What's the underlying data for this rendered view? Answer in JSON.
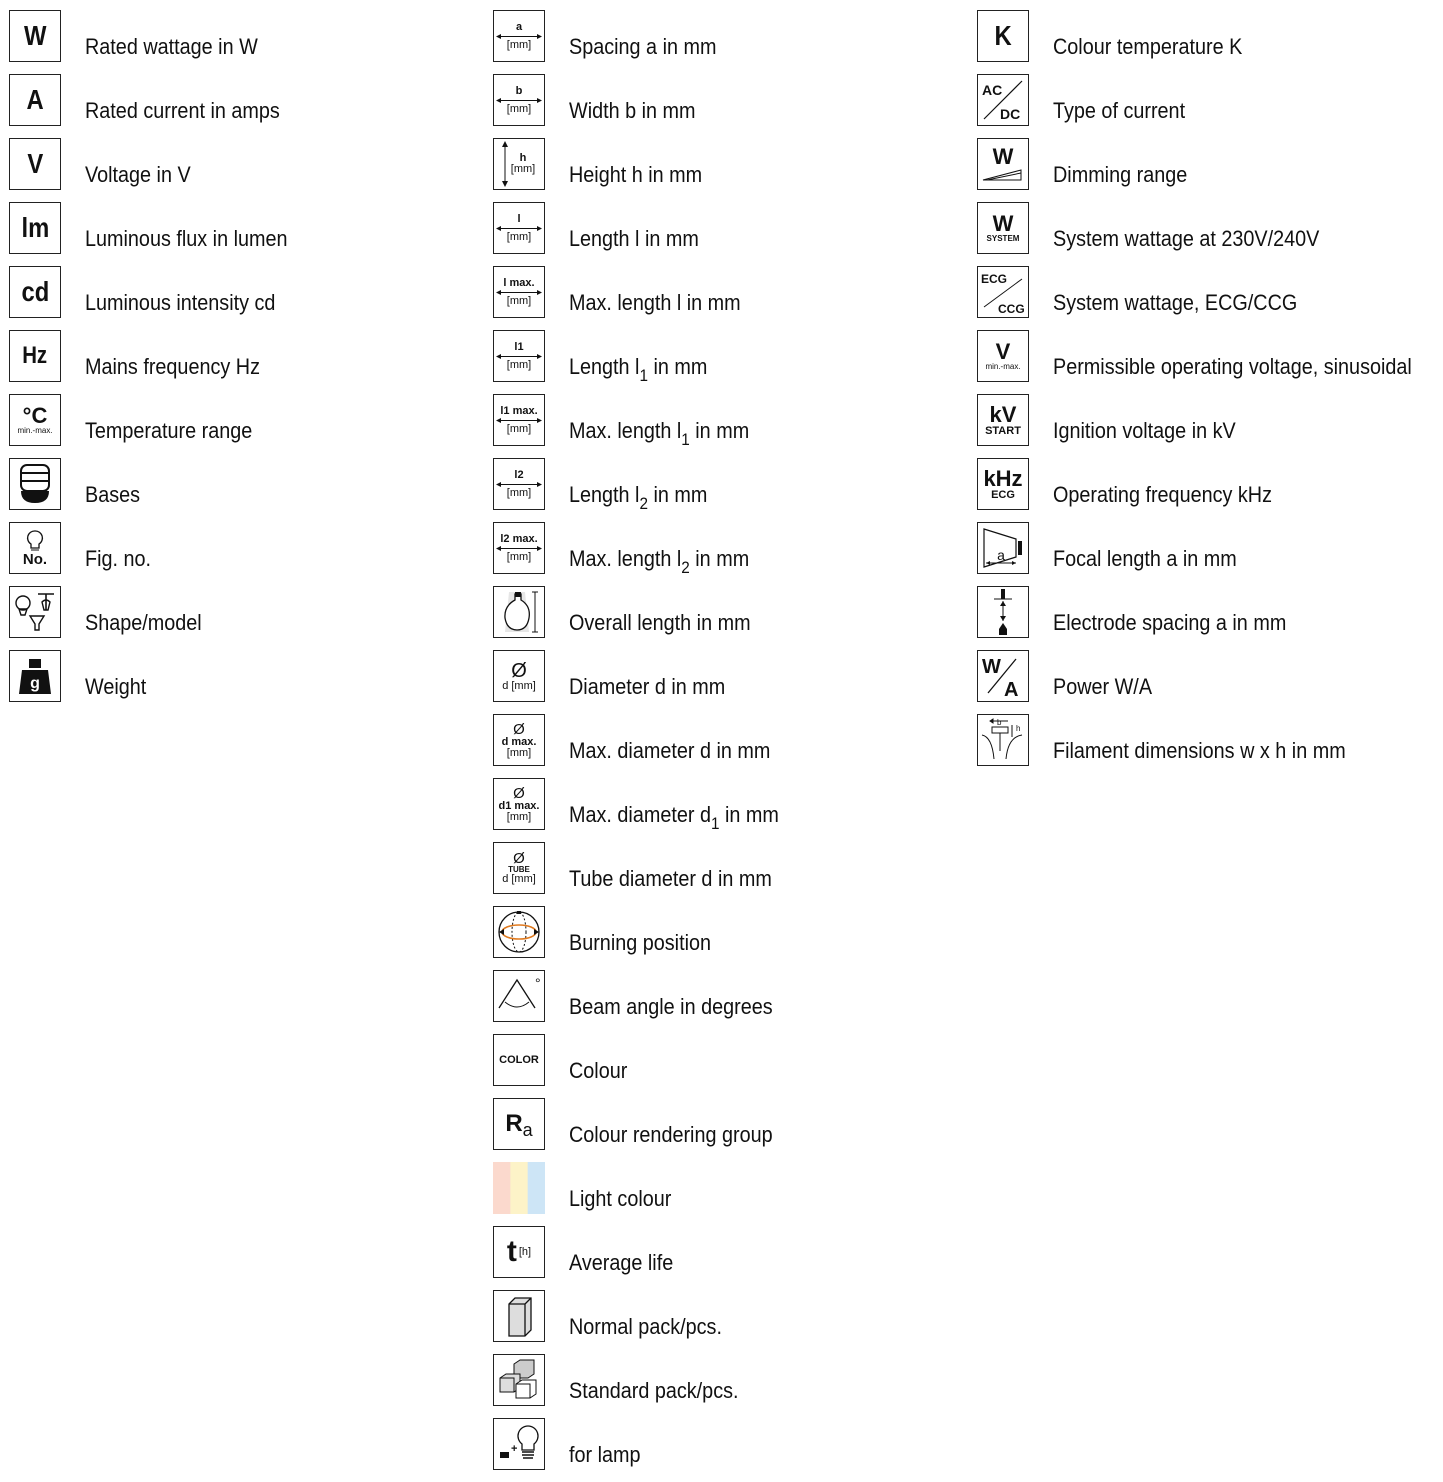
{
  "columns": [
    {
      "items": [
        {
          "icon_text": "W",
          "icon": "wattage-icon",
          "label": "Rated wattage in W"
        },
        {
          "icon_text": "A",
          "icon": "amps-icon",
          "label": "Rated current in amps"
        },
        {
          "icon_text": "V",
          "icon": "voltage-icon",
          "label": "Voltage in V"
        },
        {
          "icon_text": "lm",
          "icon": "lumen-icon",
          "label": "Luminous flux in lumen"
        },
        {
          "icon_text": "cd",
          "icon": "candela-icon",
          "label": "Luminous intensity cd"
        },
        {
          "icon_text": "Hz",
          "icon": "hertz-icon",
          "label": "Mains frequency Hz"
        },
        {
          "icon_text": "°C",
          "icon_sub": "min.-max.",
          "icon": "temperature-icon",
          "label": "Temperature range"
        },
        {
          "icon": "base-icon",
          "label": "Bases"
        },
        {
          "icon_text": "No.",
          "icon": "bulb-number-icon",
          "label": "Fig. no."
        },
        {
          "icon": "shapes-icon",
          "label": "Shape/model"
        },
        {
          "icon_text": "g",
          "icon": "weight-icon",
          "label": "Weight"
        }
      ]
    },
    {
      "items": [
        {
          "icon_text": "a",
          "icon_sub": "[mm]",
          "icon": "spacing-arrow-icon",
          "label": "Spacing a in mm"
        },
        {
          "icon_text": "b",
          "icon_sub": "[mm]",
          "icon": "width-arrow-icon",
          "label": "Width b in mm"
        },
        {
          "icon_text": "h",
          "icon_sub": "[mm]",
          "icon": "height-arrow-icon",
          "label": "Height h in mm"
        },
        {
          "icon_text": "l",
          "icon_sub": "[mm]",
          "icon": "length-arrow-icon",
          "label": "Length l in mm"
        },
        {
          "icon_text": "l max.",
          "icon_sub": "[mm]",
          "icon": "max-length-arrow-icon",
          "label": "Max. length l in mm"
        },
        {
          "icon_text": "l1",
          "icon_sub": "[mm]",
          "icon": "length1-arrow-icon",
          "label_pre": "Length l",
          "label_sub": "1",
          "label_post": " in mm"
        },
        {
          "icon_text": "l1 max.",
          "icon_sub": "[mm]",
          "icon": "max-length1-arrow-icon",
          "label_pre": "Max. length l",
          "label_sub": "1",
          "label_post": " in mm"
        },
        {
          "icon_text": "l2",
          "icon_sub": "[mm]",
          "icon": "length2-arrow-icon",
          "label_pre": "Length l",
          "label_sub": "2",
          "label_post": " in mm"
        },
        {
          "icon_text": "l2 max.",
          "icon_sub": "[mm]",
          "icon": "max-length2-arrow-icon",
          "label_pre": "Max. length l",
          "label_sub": "2",
          "label_post": " in mm"
        },
        {
          "icon": "overall-length-bulb-icon",
          "label": "Overall length in mm"
        },
        {
          "icon_text": "Ø",
          "icon_sub": "d [mm]",
          "icon": "diameter-icon",
          "label": "Diameter d in mm"
        },
        {
          "icon_text": "Ø",
          "icon_mid": "d max.",
          "icon_sub": "[mm]",
          "icon": "max-diameter-icon",
          "label": "Max. diameter d in mm"
        },
        {
          "icon_text": "Ø",
          "icon_mid": "d1 max.",
          "icon_sub": "[mm]",
          "icon": "max-diameter1-icon",
          "label_pre": "Max. diameter d",
          "label_sub": "1",
          "label_post": " in mm"
        },
        {
          "icon_text": "Ø",
          "icon_mid": "TUBE",
          "icon_sub": "d [mm]",
          "icon": "tube-diameter-icon",
          "label": "Tube diameter d in mm"
        },
        {
          "icon": "burning-position-icon",
          "label": "Burning position"
        },
        {
          "icon_text": "°",
          "icon": "beam-angle-icon",
          "label": "Beam angle in degrees"
        },
        {
          "icon_text": "COLOR",
          "icon": "color-icon",
          "label": "Colour"
        },
        {
          "icon_text": "R",
          "icon_sub": "a",
          "icon": "color-rendering-icon",
          "label": "Colour rendering group"
        },
        {
          "icon": "light-colour-icon",
          "label": "Light colour",
          "colors": [
            "#fbd9cd",
            "#fdf3c8",
            "#cde5f6"
          ]
        },
        {
          "icon_text": "t",
          "icon_sub": "[h]",
          "icon": "average-life-icon",
          "label": "Average life"
        },
        {
          "icon": "normal-pack-icon",
          "label": "Normal pack/pcs."
        },
        {
          "icon": "standard-pack-icon",
          "label": "Standard pack/pcs."
        },
        {
          "icon": "for-lamp-icon",
          "label": "for lamp"
        }
      ]
    },
    {
      "items": [
        {
          "icon_text": "K",
          "icon": "kelvin-icon",
          "label": "Colour temperature K"
        },
        {
          "icon_text": "AC",
          "icon_sub": "DC",
          "icon": "ac-dc-icon",
          "label": "Type of current"
        },
        {
          "icon_text": "W",
          "icon": "dimming-icon",
          "label": "Dimming range"
        },
        {
          "icon_text": "W",
          "icon_sub": "SYSTEM",
          "icon": "system-wattage-icon",
          "label": "System wattage at 230V/240V"
        },
        {
          "icon_text": "ECG",
          "icon_sub": "CCG",
          "icon": "ecg-ccg-icon",
          "label": "System wattage, ECG/CCG"
        },
        {
          "icon_text": "V",
          "icon_sub": "min.-max.",
          "icon": "operating-voltage-icon",
          "label": "Permissible operating voltage, sinusoidal"
        },
        {
          "icon_text": "kV",
          "icon_sub": "START",
          "icon": "ignition-voltage-icon",
          "label": "Ignition voltage in kV"
        },
        {
          "icon_text": "kHz",
          "icon_sub": "ECG",
          "icon": "operating-frequency-icon",
          "label": "Operating frequency kHz"
        },
        {
          "icon_text": "a",
          "icon": "focal-length-icon",
          "label": "Focal length a in mm"
        },
        {
          "icon": "electrode-spacing-icon",
          "label": "Electrode spacing a in mm"
        },
        {
          "icon_text": "W",
          "icon_sub": "A",
          "icon": "power-wa-icon",
          "label": "Power W/A"
        },
        {
          "icon_text": "b",
          "icon_sub": "h",
          "icon": "filament-dimensions-icon",
          "label": "Filament dimensions w x h in mm"
        }
      ]
    }
  ]
}
